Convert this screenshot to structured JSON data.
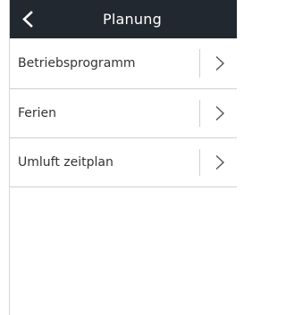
{
  "header": {
    "title": "Planung",
    "back_icon": "chevron-left-icon"
  },
  "menu": {
    "items": [
      {
        "label": "Betriebsprogramm",
        "icon": "chevron-right-icon"
      },
      {
        "label": "Ferien",
        "icon": "chevron-right-icon"
      },
      {
        "label": "Umluft zeitplan",
        "icon": "chevron-right-icon"
      }
    ]
  },
  "colors": {
    "header_background": "#21282f",
    "header_text": "#ffffff",
    "item_text": "#333333",
    "divider": "#cfcfcf",
    "chevron": "#555555"
  }
}
